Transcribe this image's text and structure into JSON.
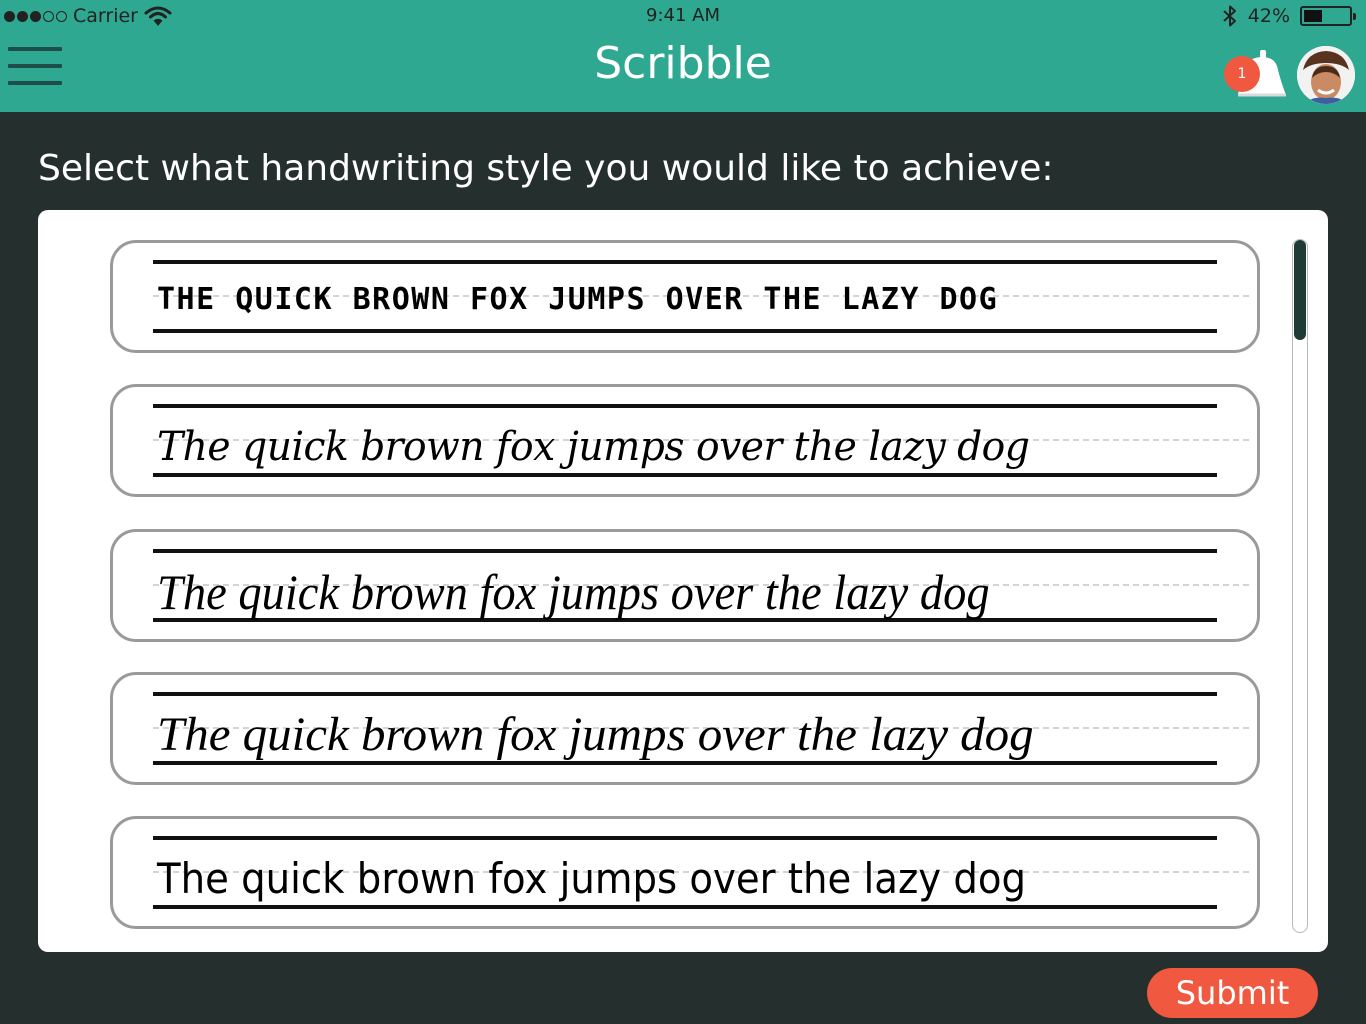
{
  "status_bar": {
    "carrier": "Carrier",
    "time": "9:41 AM",
    "battery": "42%",
    "battery_level": 0.42,
    "signal_bars_filled": 3,
    "signal_bars_total": 5
  },
  "header": {
    "title": "Scribble",
    "notification_count": "1",
    "accent_color": "#2ea890"
  },
  "main": {
    "prompt": "Select what handwriting style you would like to achieve:",
    "styles": [
      {
        "text": "THE QUICK BROWN FOX JUMPS OVER THE LAZY DOG"
      },
      {
        "text": "The quick brown fox jumps over the lazy dog"
      },
      {
        "text": "The quick brown fox jumps over the lazy dog"
      },
      {
        "text": "The quick brown fox jumps over the lazy dog"
      },
      {
        "text": "The quick brown fox jumps over the lazy dog"
      }
    ],
    "submit_label": "Submit",
    "submit_color": "#f0583f"
  }
}
